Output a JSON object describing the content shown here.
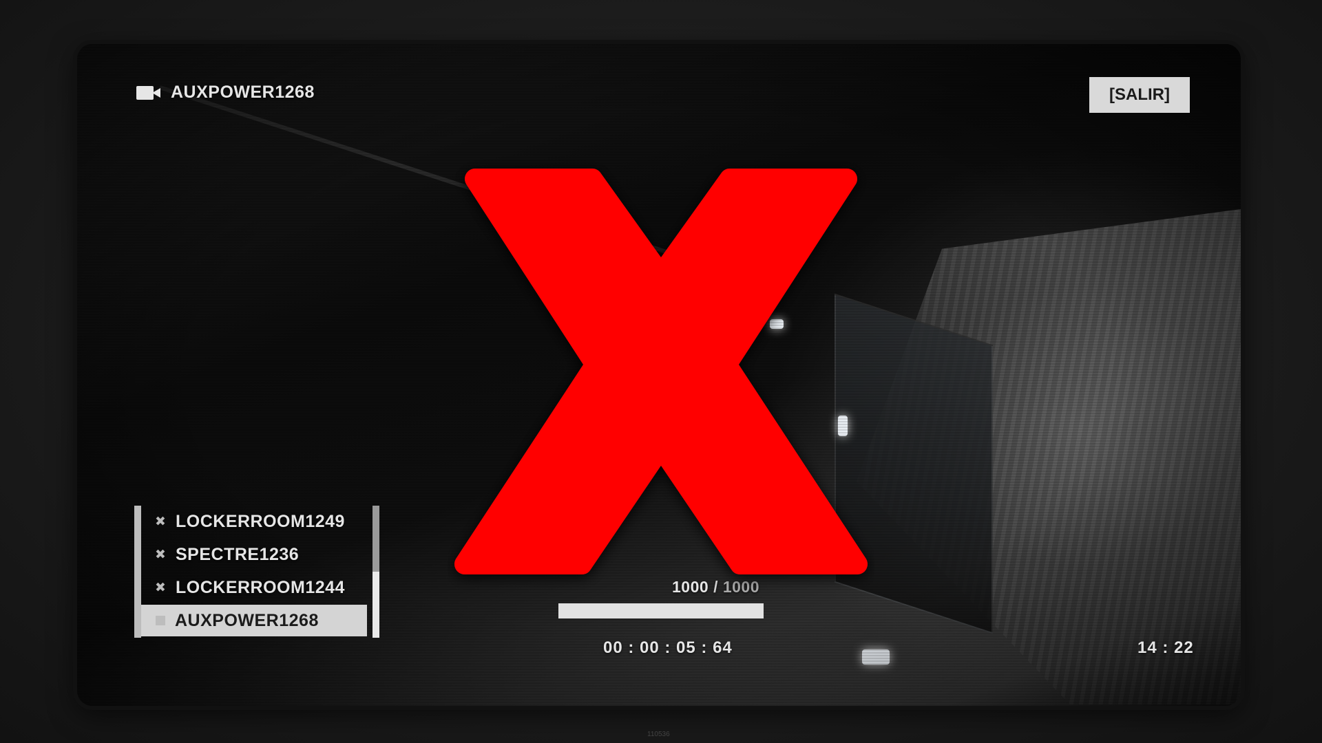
{
  "camera": {
    "current_name": "AUXPOWER1268",
    "icon": "video-camera-icon"
  },
  "exit_button": {
    "label": "[SALIR]"
  },
  "camera_list": {
    "items": [
      {
        "label": "LOCKERROOM1249",
        "icon": "x-icon",
        "selected": false
      },
      {
        "label": "SPECTRE1236",
        "icon": "x-icon",
        "selected": false
      },
      {
        "label": "LOCKERROOM1244",
        "icon": "x-icon",
        "selected": false
      },
      {
        "label": "AUXPOWER1268",
        "icon": "square-icon",
        "selected": true
      }
    ]
  },
  "power": {
    "current": "1000",
    "separator": "/",
    "max": "1000",
    "fraction": 1.0
  },
  "elapsed_time": "00 : 00 : 05 : 64",
  "clock": "14 : 22",
  "overlay": {
    "symbol": "big-red-x-icon",
    "color": "#ff0000"
  },
  "watermark": "110536"
}
